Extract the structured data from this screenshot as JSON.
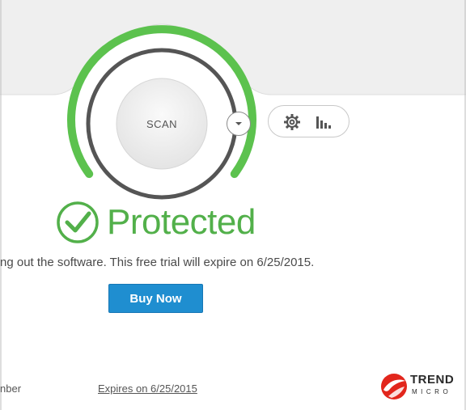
{
  "scan": {
    "label": "SCAN",
    "dropdown_icon": "chevron-down-icon"
  },
  "toolbar": {
    "settings_icon": "gear-icon",
    "reports_icon": "bar-chart-icon"
  },
  "status": {
    "icon": "check-circle-icon",
    "text": "Protected",
    "color": "#52b04a"
  },
  "trial": {
    "message": "ng out the software. This free trial will expire on 6/25/2015."
  },
  "buy": {
    "label": "Buy Now",
    "color": "#1f8ed0"
  },
  "footer": {
    "serial_label": "nber",
    "expires_link": "Expires on 6/25/2015"
  },
  "logo": {
    "brand": "TREND",
    "sub": "MICRO",
    "color": "#e2261c"
  }
}
